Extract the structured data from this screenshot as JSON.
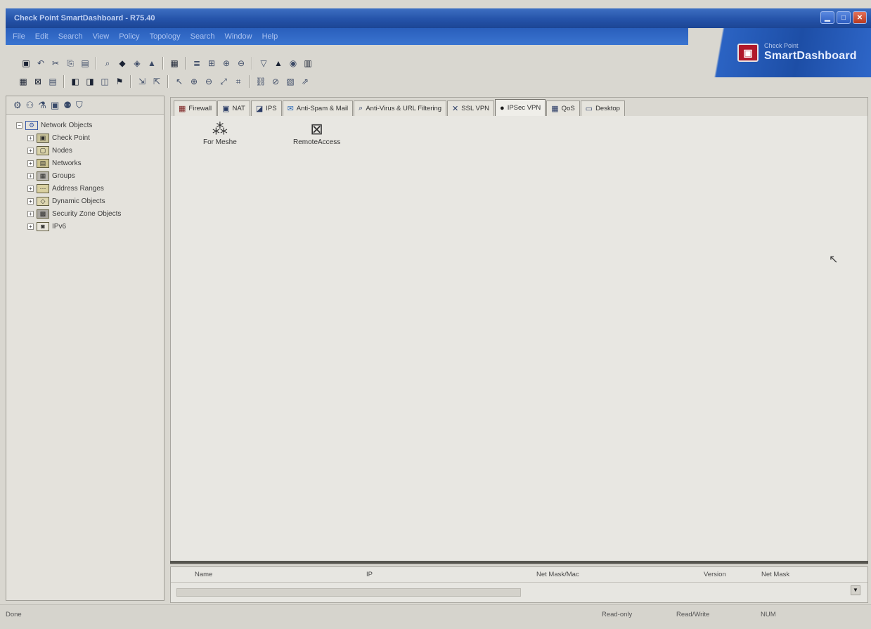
{
  "window": {
    "title": "Check Point SmartDashboard - R75.40",
    "controls": [
      "minimize-icon",
      "maximize-icon",
      "close-icon"
    ]
  },
  "menu": [
    "File",
    "Edit",
    "Search",
    "View",
    "Policy",
    "Topology",
    "Search",
    "Window",
    "Help"
  ],
  "brand": {
    "vendor": "Check Point",
    "product": "SmartDashboard"
  },
  "toolbar1": [
    "save-icon",
    "undo-icon",
    "cut-icon",
    "copy-icon",
    "paste-icon",
    "find-icon",
    "install-icon",
    "verify-icon",
    "view-icon",
    "network-icon",
    "rule-icon",
    "table-icon",
    "add-icon",
    "delete-icon",
    "filter-icon",
    "alert-icon",
    "log-icon",
    "book-icon"
  ],
  "toolbar2": [
    "layout-icon",
    "grid-icon",
    "list-icon",
    "panel-icon",
    "panel2-icon",
    "split-icon",
    "flag-icon",
    "hide-icon",
    "show-icon",
    "select-icon",
    "zoom-in-icon",
    "zoom-out-icon",
    "fit-icon",
    "arrange-icon",
    "link-icon",
    "unlink-icon",
    "map-icon",
    "export-icon"
  ],
  "sidebar": {
    "tabs": [
      "objects-tab-icon",
      "services-tab-icon",
      "resources-tab-icon",
      "servers-tab-icon",
      "users-tab-icon",
      "vpn-tab-icon"
    ],
    "root": "Network Objects",
    "items": [
      {
        "label": "Check Point",
        "icon": "checkpoint-icon"
      },
      {
        "label": "Nodes",
        "icon": "node-icon"
      },
      {
        "label": "Networks",
        "icon": "network-icon"
      },
      {
        "label": "Groups",
        "icon": "group-icon"
      },
      {
        "label": "Address Ranges",
        "icon": "range-icon"
      },
      {
        "label": "Dynamic Objects",
        "icon": "dynamic-icon"
      },
      {
        "label": "Security Zone Objects",
        "icon": "zone-icon"
      },
      {
        "label": "IPv6",
        "icon": "ipv6-icon"
      }
    ]
  },
  "tabs": [
    {
      "label": "Firewall",
      "icon": "firewall-icon",
      "active": false
    },
    {
      "label": "NAT",
      "icon": "nat-icon",
      "active": false
    },
    {
      "label": "IPS",
      "icon": "ips-icon",
      "active": false
    },
    {
      "label": "Anti-Spam & Mail",
      "icon": "antispam-icon",
      "active": false
    },
    {
      "label": "Anti-Virus & URL Filtering",
      "icon": "antivirus-icon",
      "active": false
    },
    {
      "label": "SSL VPN",
      "icon": "sslvpn-icon",
      "active": false
    },
    {
      "label": "IPSec VPN",
      "icon": "ipsec-icon",
      "active": true
    },
    {
      "label": "QoS",
      "icon": "qos-icon",
      "active": false
    },
    {
      "label": "Desktop",
      "icon": "desktop-icon",
      "active": false
    }
  ],
  "communities": [
    {
      "label": "For Meshe",
      "icon": "star-community-icon"
    },
    {
      "label": "RemoteAccess",
      "icon": "mesh-community-icon"
    }
  ],
  "bottom_pane": {
    "columns": [
      "Name",
      "IP",
      "Net Mask/Mac",
      "Version",
      "Net Mask"
    ],
    "scroll_arrow": "▼"
  },
  "status": {
    "left": "Done",
    "items": [
      "Read-only",
      "Read/Write",
      "NUM"
    ]
  }
}
